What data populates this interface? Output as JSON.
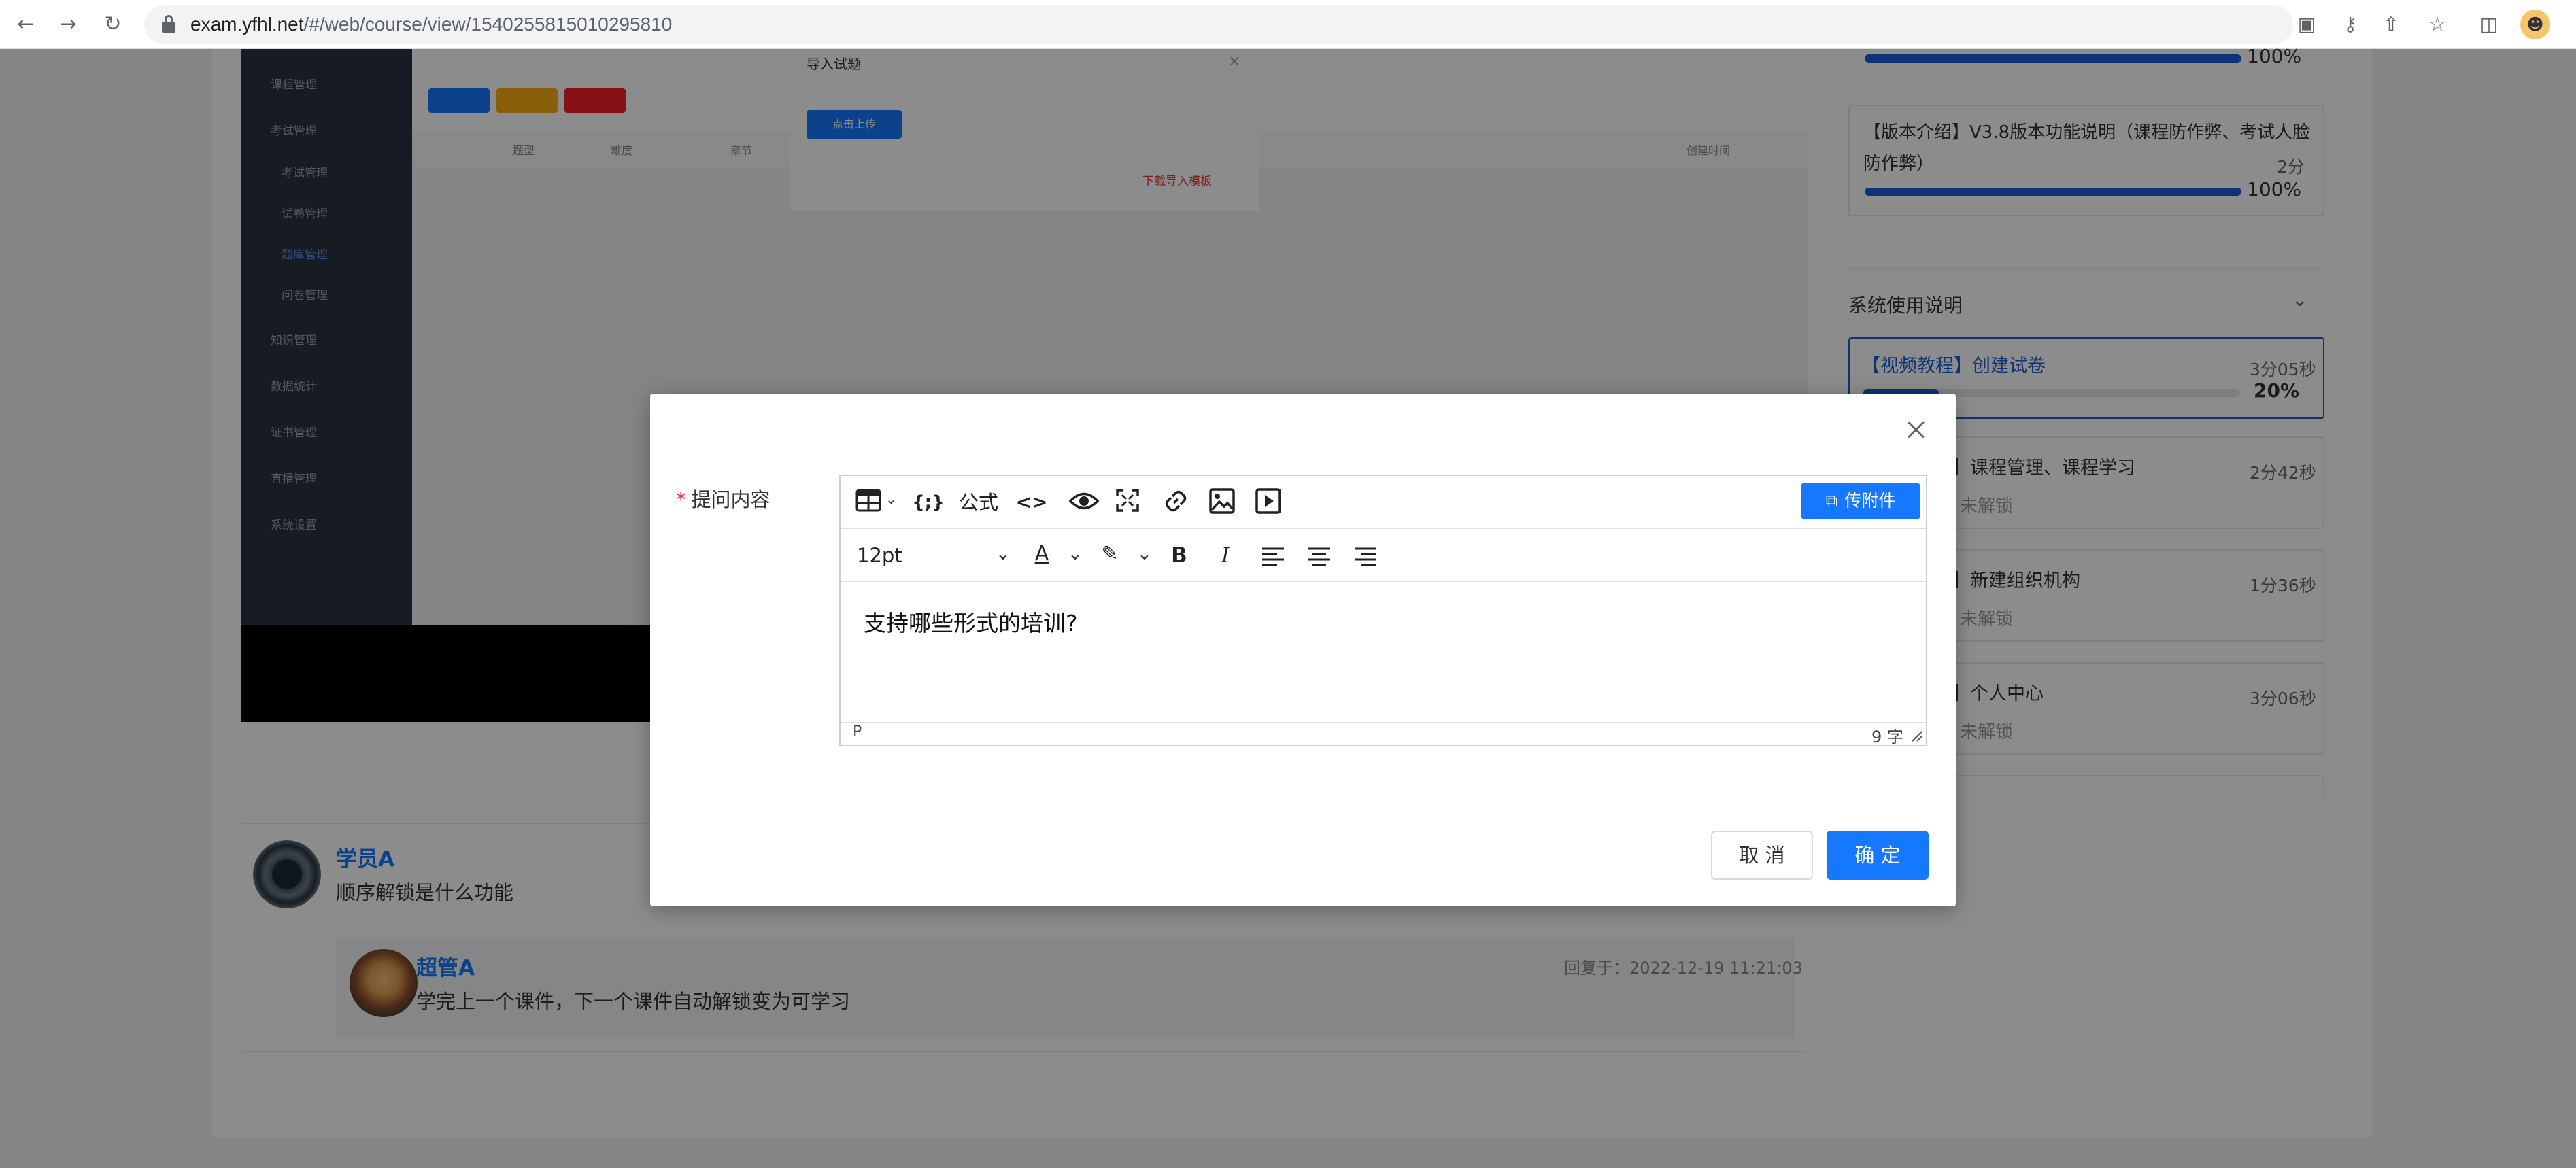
{
  "browser": {
    "url_host": "exam.yfhl.net",
    "url_path": "/#/web/course/view/1540255815010295810"
  },
  "background_screen": {
    "sidebar_items": [
      "课程管理",
      "考试管理",
      "考试管理",
      "试卷管理",
      "题库管理",
      "问卷管理",
      "知识管理",
      "数据统计",
      "证书管理",
      "直播管理",
      "系统设置"
    ],
    "import_dialog": {
      "title": "导入试题",
      "upload_label": "点击上传",
      "template_label": "下载导入模板"
    },
    "table_headers": [
      "题型",
      "难度",
      "章节",
      "创建时间"
    ]
  },
  "right_panel": {
    "top_progress": {
      "pct_label": "100%",
      "fill": 1.0
    },
    "version_card": {
      "title": "【版本介绍】V3.8版本功能说明（课程防作弊、考试人脸防作弊）",
      "duration": "2分",
      "pct_label": "100%",
      "fill": 1.0
    },
    "section_title": "系统使用说明",
    "lessons": [
      {
        "title": "【视频教程】创建试卷",
        "duration": "3分05秒",
        "pct_label": "20%",
        "fill": 0.2,
        "active": true
      },
      {
        "title": "】课程管理、课程学习",
        "duration": "2分42秒",
        "sub": "未解锁"
      },
      {
        "title": "】新建组织机构",
        "duration": "1分36秒",
        "sub": "未解锁"
      },
      {
        "title": "】个人中心",
        "duration": "3分06秒",
        "sub": "未解锁"
      }
    ]
  },
  "comments": {
    "main": {
      "name": "学员A",
      "text": "顺序解锁是什么功能"
    },
    "reply": {
      "name": "超管A",
      "text": "学完上一个课件，下一个课件自动解锁变为可学习",
      "time": "回复于：2022-12-19 11:21:03"
    }
  },
  "modal": {
    "field_label": "提问内容",
    "toolbar": {
      "formula_label": "公式",
      "font_size": "12pt",
      "attach_label": "传附件"
    },
    "content": "支持哪些形式的培训?",
    "status_path": "P",
    "word_count": "9 字",
    "cancel_label": "取 消",
    "ok_label": "确 定"
  },
  "colors": {
    "primary": "#1677ff",
    "progress": "#1660d6",
    "required": "#f5222d"
  }
}
